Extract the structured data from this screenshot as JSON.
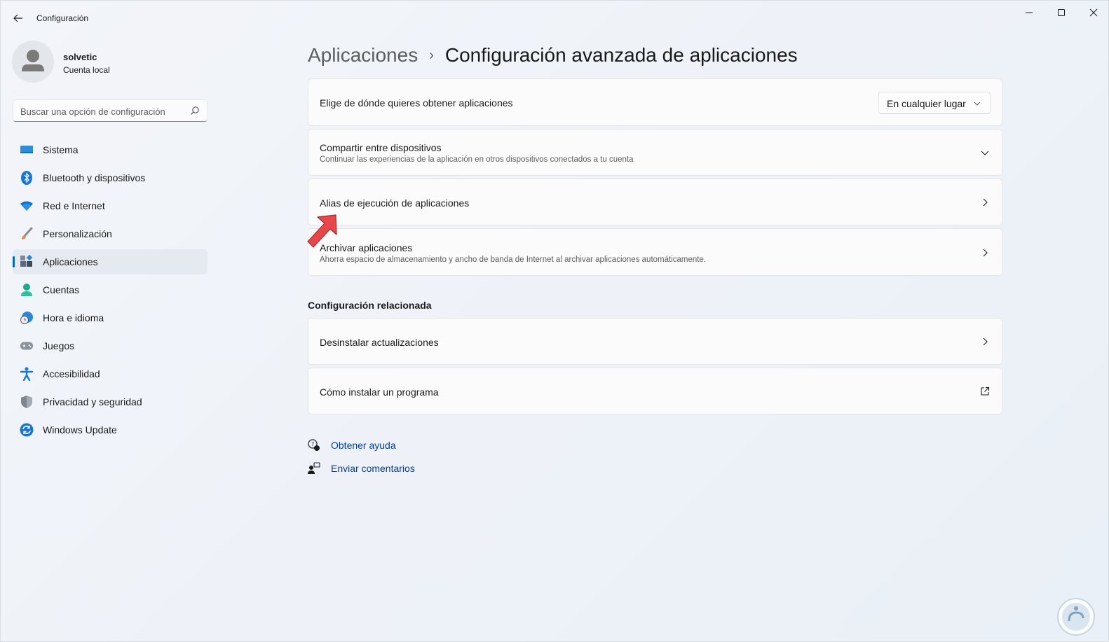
{
  "window": {
    "title": "Configuración",
    "controls": [
      "minimize",
      "maximize",
      "close"
    ]
  },
  "profile": {
    "name": "solvetic",
    "account_type": "Cuenta local"
  },
  "search": {
    "placeholder": "Buscar una opción de configuración"
  },
  "sidebar": {
    "items": [
      {
        "label": "Sistema",
        "icon": "system-icon",
        "active": false
      },
      {
        "label": "Bluetooth y dispositivos",
        "icon": "bluetooth-icon",
        "active": false
      },
      {
        "label": "Red e Internet",
        "icon": "wifi-icon",
        "active": false
      },
      {
        "label": "Personalización",
        "icon": "brush-icon",
        "active": false
      },
      {
        "label": "Aplicaciones",
        "icon": "apps-icon",
        "active": true
      },
      {
        "label": "Cuentas",
        "icon": "account-icon",
        "active": false
      },
      {
        "label": "Hora e idioma",
        "icon": "time-language-icon",
        "active": false
      },
      {
        "label": "Juegos",
        "icon": "gamepad-icon",
        "active": false
      },
      {
        "label": "Accesibilidad",
        "icon": "accessibility-icon",
        "active": false
      },
      {
        "label": "Privacidad y seguridad",
        "icon": "shield-icon",
        "active": false
      },
      {
        "label": "Windows Update",
        "icon": "update-icon",
        "active": false
      }
    ]
  },
  "breadcrumb": {
    "parent": "Aplicaciones",
    "separator": "›",
    "current": "Configuración avanzada de aplicaciones"
  },
  "settings": {
    "source": {
      "title": "Elige de dónde quieres obtener aplicaciones",
      "dropdown_value": "En cualquier lugar"
    },
    "share": {
      "title": "Compartir entre dispositivos",
      "subtitle": "Continuar las experiencias de la aplicación en otros dispositivos conectados a tu cuenta"
    },
    "alias": {
      "title": "Alias de ejecución de aplicaciones"
    },
    "archive": {
      "title": "Archivar aplicaciones",
      "subtitle": "Ahorra espacio de almacenamiento y ancho de banda de Internet al archivar aplicaciones automáticamente."
    }
  },
  "related": {
    "heading": "Configuración relacionada",
    "uninstall_updates": "Desinstalar actualizaciones",
    "how_to_install": "Cómo instalar un programa"
  },
  "help": {
    "get_help": "Obtener ayuda",
    "feedback": "Enviar comentarios"
  },
  "colors": {
    "accent": "#0067c0",
    "link": "#003e92",
    "annotation_arrow": "#e8474a"
  }
}
